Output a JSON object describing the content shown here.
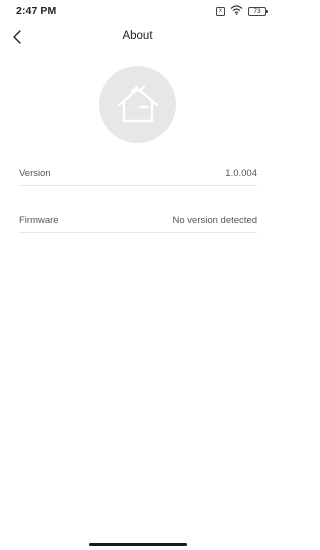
{
  "status_bar": {
    "time": "2:47 PM",
    "sim_label": "x",
    "battery_level": "73",
    "icons": [
      "sim-icon",
      "wifi-icon",
      "battery-icon"
    ]
  },
  "header": {
    "title": "About",
    "back_icon": "chevron-left-icon"
  },
  "logo": {
    "icon": "home-icon",
    "background_color": "#e7e7e7"
  },
  "info": {
    "version_label": "Version",
    "version_value": "1.0.004",
    "firmware_label": "Firmware",
    "firmware_value": "No version detected"
  }
}
